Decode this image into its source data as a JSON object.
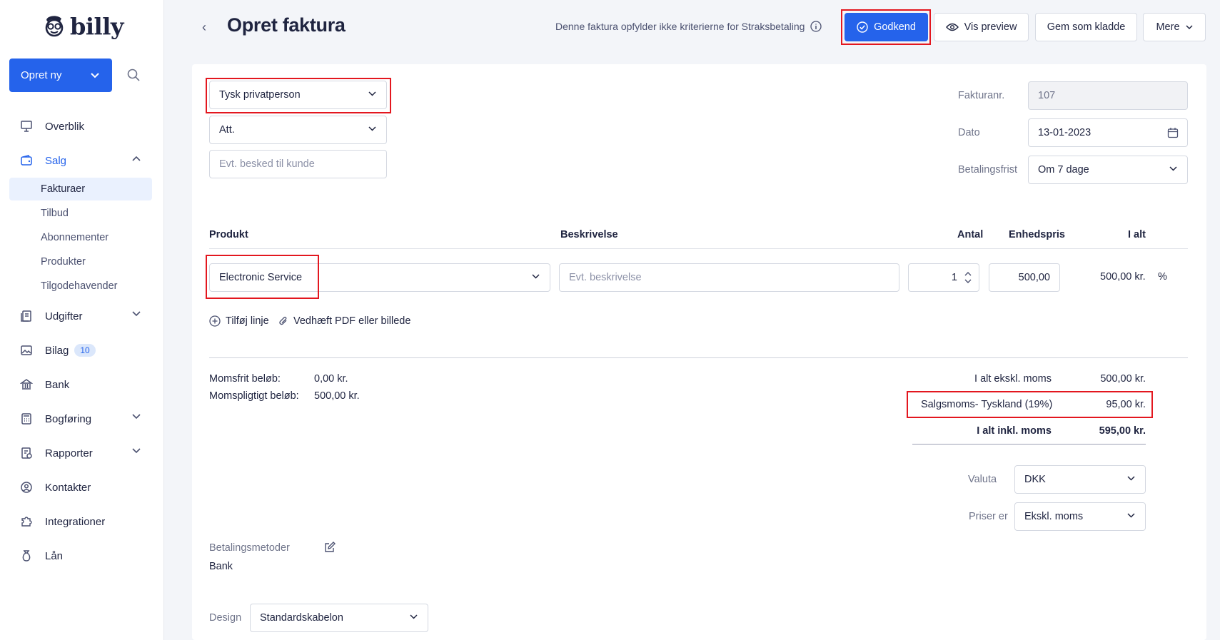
{
  "app": {
    "logo_text": "billy"
  },
  "sidebar": {
    "new_button": "Opret ny",
    "items": [
      {
        "label": "Overblik",
        "icon": "presentation-icon"
      },
      {
        "label": "Salg",
        "icon": "wallet-icon"
      },
      {
        "label": "Udgifter",
        "icon": "receipt-icon"
      },
      {
        "label": "Bilag",
        "icon": "image-icon",
        "badge": "10"
      },
      {
        "label": "Bank",
        "icon": "bank-icon"
      },
      {
        "label": "Bogføring",
        "icon": "calculator-icon"
      },
      {
        "label": "Rapporter",
        "icon": "report-icon"
      },
      {
        "label": "Kontakter",
        "icon": "contact-icon"
      },
      {
        "label": "Integrationer",
        "icon": "puzzle-icon"
      },
      {
        "label": "Lån",
        "icon": "money-bag-icon"
      }
    ],
    "sales_subitems": [
      "Fakturaer",
      "Tilbud",
      "Abonnementer",
      "Produkter",
      "Tilgodehavender"
    ]
  },
  "header": {
    "title": "Opret faktura",
    "note": "Denne faktura opfylder ikke kriterierne for Straksbetaling",
    "approve": "Godkend",
    "preview": "Vis preview",
    "save_draft": "Gem som kladde",
    "more": "Mere"
  },
  "customer": {
    "contact": "Tysk privatperson",
    "att": "Att.",
    "message_placeholder": "Evt. besked til kunde"
  },
  "meta": {
    "invoice_no_label": "Fakturanr.",
    "invoice_no": "107",
    "date_label": "Dato",
    "date": "13-01-2023",
    "due_label": "Betalingsfrist",
    "due": "Om 7 dage"
  },
  "lines": {
    "headers": {
      "product": "Produkt",
      "description": "Beskrivelse",
      "qty": "Antal",
      "unit_price": "Enhedspris",
      "total": "I alt"
    },
    "row": {
      "product": "Electronic Service",
      "description_placeholder": "Evt. beskrivelse",
      "qty": "1",
      "unit_price": "500,00",
      "total": "500,00 kr.",
      "percent": "%"
    },
    "add_line": "Tilføj linje",
    "attach": "Vedhæft PDF eller billede"
  },
  "totals": {
    "vat_free_label": "Momsfrit beløb:",
    "vat_free": "0,00 kr.",
    "vat_liable_label": "Momspligtigt beløb:",
    "vat_liable": "500,00 kr.",
    "excl_label": "I alt ekskl. moms",
    "excl": "500,00 kr.",
    "vat_label": "Salgsmoms- Tyskland (19%)",
    "vat": "95,00 kr.",
    "incl_label": "I alt inkl. moms",
    "incl": "595,00 kr."
  },
  "options": {
    "currency_label": "Valuta",
    "currency": "DKK",
    "prices_label": "Priser er",
    "prices": "Ekskl. moms"
  },
  "payment": {
    "label": "Betalingsmetoder",
    "method": "Bank"
  },
  "design": {
    "label": "Design",
    "value": "Standardskabelon"
  },
  "colors": {
    "primary": "#2563eb",
    "highlight": "#e3171f"
  }
}
